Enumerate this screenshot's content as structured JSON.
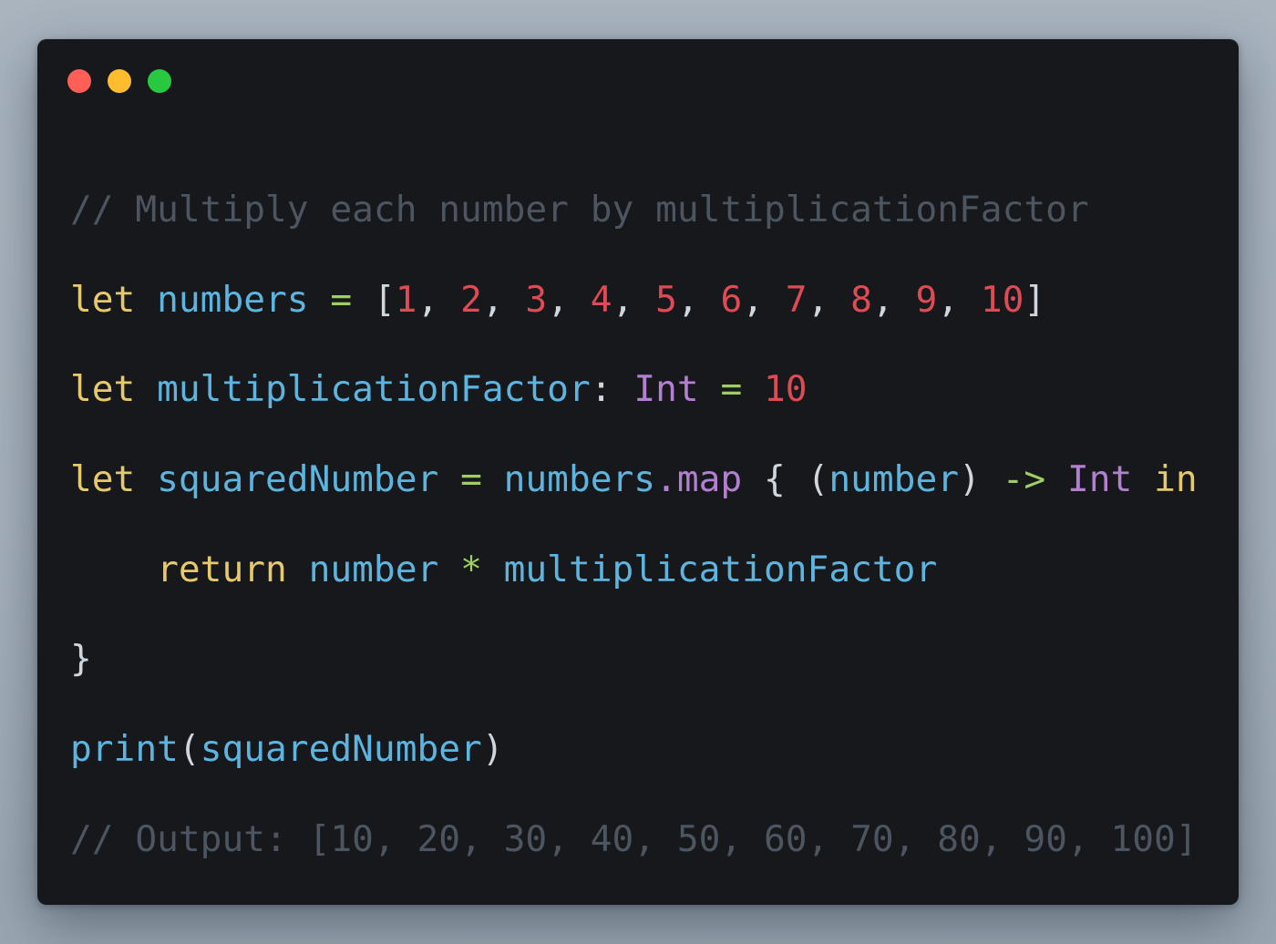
{
  "window": {
    "buttons": [
      "close",
      "minimize",
      "zoom"
    ],
    "colors": {
      "close": "#ff5f57",
      "minimize": "#febc2e",
      "zoom": "#28c840",
      "background": "#16181b"
    }
  },
  "code": {
    "language": "swift",
    "lines": [
      [
        {
          "text": "// Multiply each number by multiplicationFactor",
          "t": "comment"
        }
      ],
      [
        {
          "text": "let",
          "t": "kw"
        },
        {
          "text": " ",
          "t": "punc"
        },
        {
          "text": "numbers",
          "t": "id"
        },
        {
          "text": " ",
          "t": "punc"
        },
        {
          "text": "=",
          "t": "op"
        },
        {
          "text": " ",
          "t": "punc"
        },
        {
          "text": "[",
          "t": "punc"
        },
        {
          "text": "1",
          "t": "num"
        },
        {
          "text": ", ",
          "t": "punc"
        },
        {
          "text": "2",
          "t": "num"
        },
        {
          "text": ", ",
          "t": "punc"
        },
        {
          "text": "3",
          "t": "num"
        },
        {
          "text": ", ",
          "t": "punc"
        },
        {
          "text": "4",
          "t": "num"
        },
        {
          "text": ", ",
          "t": "punc"
        },
        {
          "text": "5",
          "t": "num"
        },
        {
          "text": ", ",
          "t": "punc"
        },
        {
          "text": "6",
          "t": "num"
        },
        {
          "text": ", ",
          "t": "punc"
        },
        {
          "text": "7",
          "t": "num"
        },
        {
          "text": ", ",
          "t": "punc"
        },
        {
          "text": "8",
          "t": "num"
        },
        {
          "text": ", ",
          "t": "punc"
        },
        {
          "text": "9",
          "t": "num"
        },
        {
          "text": ", ",
          "t": "punc"
        },
        {
          "text": "10",
          "t": "num"
        },
        {
          "text": "]",
          "t": "punc"
        }
      ],
      [
        {
          "text": "let",
          "t": "kw"
        },
        {
          "text": " ",
          "t": "punc"
        },
        {
          "text": "multiplicationFactor",
          "t": "id"
        },
        {
          "text": ": ",
          "t": "punc"
        },
        {
          "text": "Int",
          "t": "type"
        },
        {
          "text": " ",
          "t": "punc"
        },
        {
          "text": "=",
          "t": "op"
        },
        {
          "text": " ",
          "t": "punc"
        },
        {
          "text": "10",
          "t": "num"
        }
      ],
      [
        {
          "text": "let",
          "t": "kw"
        },
        {
          "text": " ",
          "t": "punc"
        },
        {
          "text": "squaredNumber",
          "t": "id"
        },
        {
          "text": " ",
          "t": "punc"
        },
        {
          "text": "=",
          "t": "op"
        },
        {
          "text": " ",
          "t": "punc"
        },
        {
          "text": "numbers",
          "t": "id"
        },
        {
          "text": ".map",
          "t": "type"
        },
        {
          "text": " ",
          "t": "punc"
        },
        {
          "text": "{",
          "t": "punc"
        },
        {
          "text": " (",
          "t": "punc"
        },
        {
          "text": "number",
          "t": "id"
        },
        {
          "text": ") ",
          "t": "punc"
        },
        {
          "text": "->",
          "t": "op"
        },
        {
          "text": " ",
          "t": "punc"
        },
        {
          "text": "Int",
          "t": "type"
        },
        {
          "text": " ",
          "t": "punc"
        },
        {
          "text": "in",
          "t": "kw"
        }
      ],
      [
        {
          "text": "    ",
          "t": "punc"
        },
        {
          "text": "return",
          "t": "kw"
        },
        {
          "text": " ",
          "t": "punc"
        },
        {
          "text": "number",
          "t": "id"
        },
        {
          "text": " ",
          "t": "punc"
        },
        {
          "text": "*",
          "t": "op"
        },
        {
          "text": " ",
          "t": "punc"
        },
        {
          "text": "multiplicationFactor",
          "t": "id"
        }
      ],
      [
        {
          "text": "}",
          "t": "punc"
        }
      ],
      [
        {
          "text": "print",
          "t": "id"
        },
        {
          "text": "(",
          "t": "punc"
        },
        {
          "text": "squaredNumber",
          "t": "id"
        },
        {
          "text": ")",
          "t": "punc"
        }
      ],
      [
        {
          "text": "// Output: [10, 20, 30, 40, 50, 60, 70, 80, 90, 100]",
          "t": "comment"
        }
      ]
    ]
  }
}
